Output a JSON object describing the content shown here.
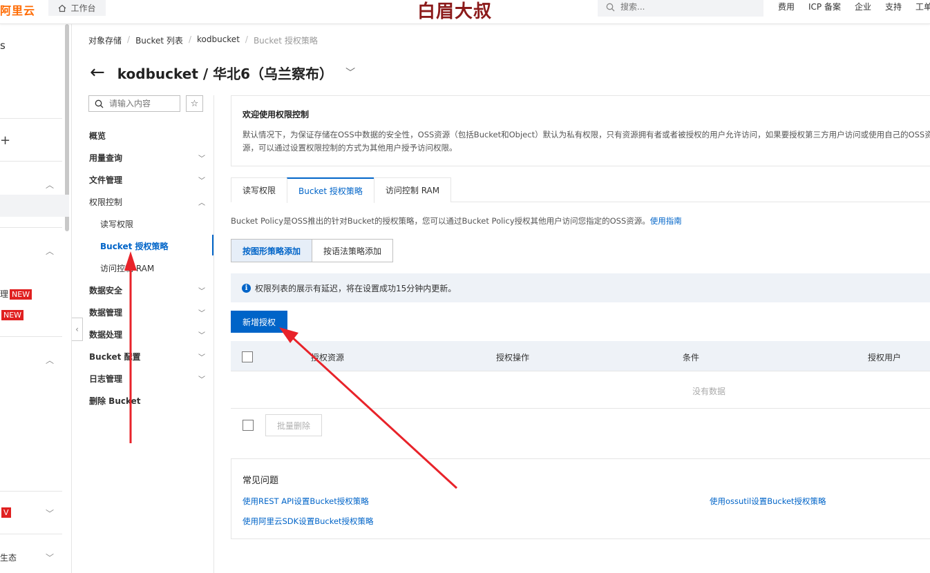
{
  "topbar": {
    "logo": "阿里云",
    "workbench": "工作台",
    "brand": "白眉大叔",
    "search_placeholder": "搜索...",
    "links": [
      "费用",
      "ICP 备案",
      "企业",
      "支持",
      "工单"
    ]
  },
  "rail": {
    "top_fragment": "s",
    "plus": "+",
    "new1_prefix": "理",
    "new_badge": "NEW",
    "new7_badge": "V",
    "bottom_fragment": "生态"
  },
  "breadcrumb": [
    "对象存储",
    "Bucket 列表",
    "kodbucket",
    "Bucket 授权策略"
  ],
  "page_title": "kodbucket / 华北6（乌兰察布）",
  "menu": {
    "search_placeholder": "请输入内容",
    "items": [
      {
        "label": "概览"
      },
      {
        "label": "用量查询"
      },
      {
        "label": "文件管理"
      },
      {
        "label": "权限控制"
      },
      {
        "label": "读写权限"
      },
      {
        "label": "Bucket 授权策略"
      },
      {
        "label": "访问控制 RAM"
      },
      {
        "label": "数据安全"
      },
      {
        "label": "数据管理"
      },
      {
        "label": "数据处理"
      },
      {
        "label": "Bucket 配置"
      },
      {
        "label": "日志管理"
      },
      {
        "label": "删除 Bucket"
      }
    ]
  },
  "welcome": {
    "title": "欢迎使用权限控制",
    "text": "默认情况下，为保证存储在OSS中数据的安全性，OSS资源（包括Bucket和Object）默认为私有权限，只有资源拥有者或者被授权的用户允许访问，如果要授权第三方用户访问或使用自己的OSS资源，可以通过设置权限控制的方式为其他用户授予访问权限。"
  },
  "tabs": [
    "读写权限",
    "Bucket 授权策略",
    "访问控制 RAM"
  ],
  "policy": {
    "desc": "Bucket Policy是OSS推出的针对Bucket的授权策略，您可以通过Bucket Policy授权其他用户访问您指定的OSS资源。",
    "guide_link": "使用指南"
  },
  "seg": [
    "按图形策略添加",
    "按语法策略添加"
  ],
  "notice": "权限列表的展示有延迟，将在设置成功15分钟内更新。",
  "add_button": "新增授权",
  "table": {
    "columns": [
      "授权资源",
      "授权操作",
      "条件",
      "授权用户"
    ],
    "empty": "没有数据"
  },
  "batch_delete": "批量删除",
  "faq": {
    "title": "常见问题",
    "links": [
      "使用REST API设置Bucket授权策略",
      "使用ossutil设置Bucket授权策略",
      "使用阿里云SDK设置Bucket授权策略"
    ]
  },
  "colors": {
    "accent": "#0064c8",
    "annotation": "#e8232a",
    "brand_orange": "#ff6a00"
  }
}
